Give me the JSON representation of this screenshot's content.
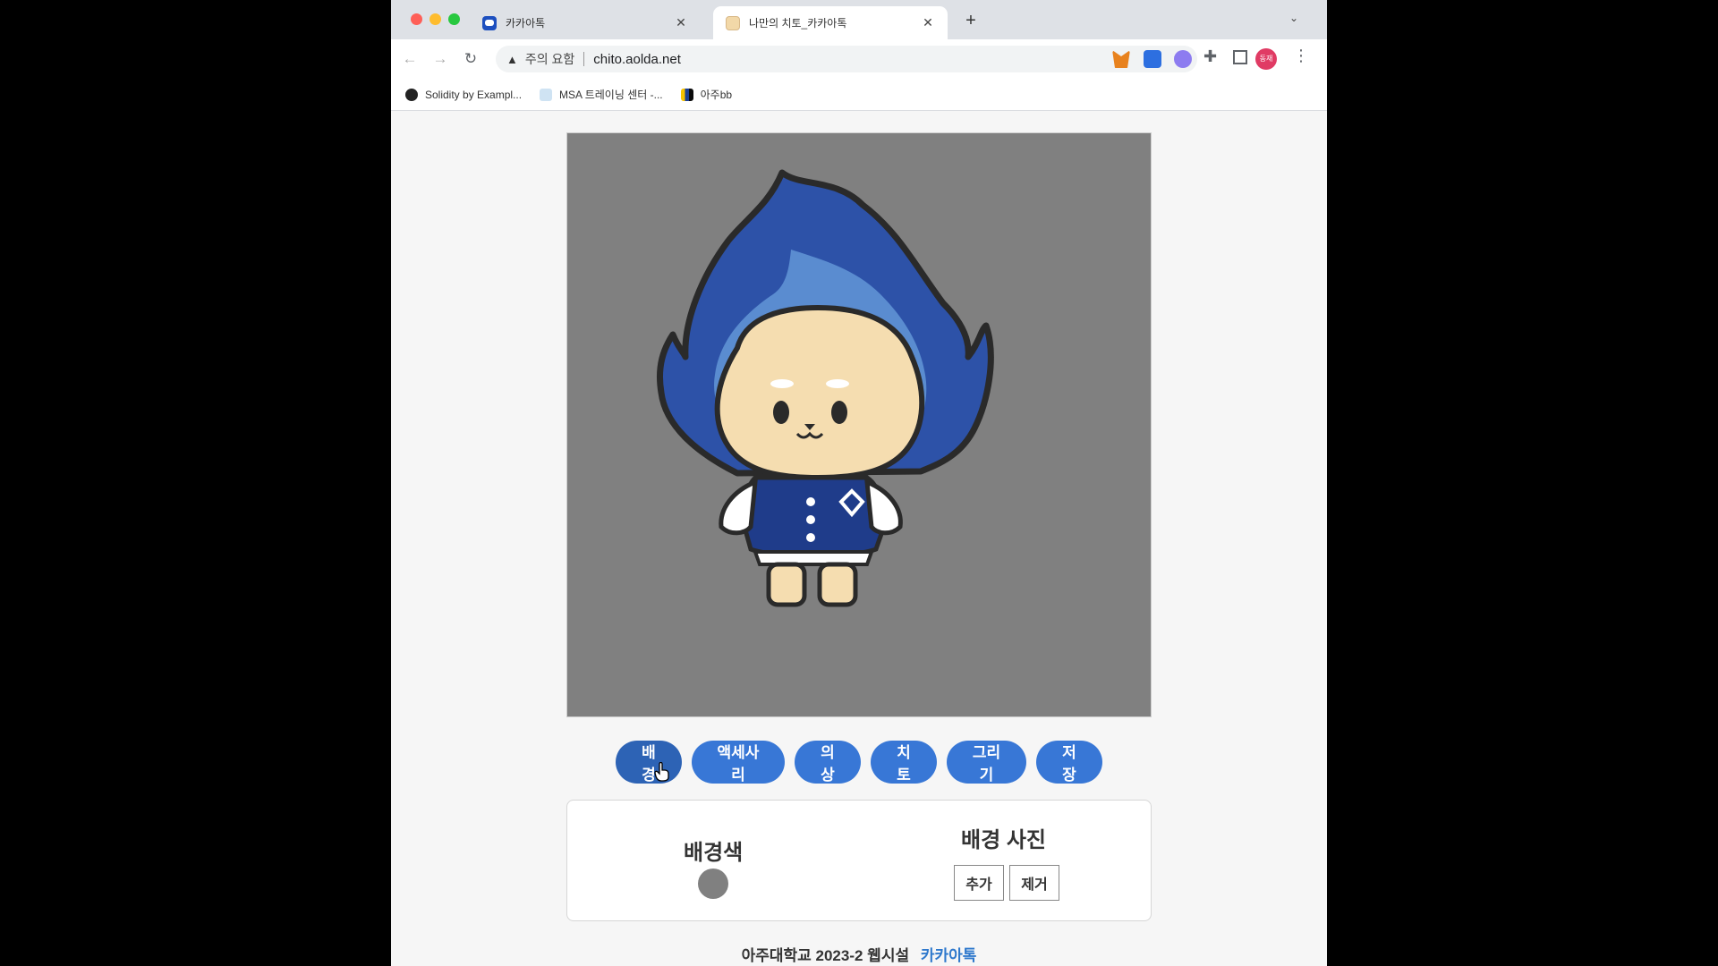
{
  "browser": {
    "tabs": [
      {
        "title": "카카아톡"
      },
      {
        "title": "나만의 치토_카카아톡"
      }
    ],
    "omnibox": {
      "warning": "주의 요함",
      "url": "chito.aolda.net"
    },
    "profile_initials": "동재",
    "bookmarks": [
      {
        "label": "Solidity by Exampl..."
      },
      {
        "label": "MSA 트레이닝 센터 -..."
      },
      {
        "label": "아주bb"
      }
    ]
  },
  "canvas": {
    "background_color": "#808080"
  },
  "toolbar": {
    "buttons": [
      {
        "label": "배경"
      },
      {
        "label": "액세사리"
      },
      {
        "label": "의상"
      },
      {
        "label": "치토"
      },
      {
        "label": "그리기"
      },
      {
        "label": "저장"
      }
    ],
    "active": "배경"
  },
  "panel": {
    "bg_color_title": "배경색",
    "bg_photo_title": "배경 사진",
    "add_label": "추가",
    "remove_label": "제거"
  },
  "footer": {
    "text": "아주대학교 2023-2 웹시설",
    "link": "카카아톡"
  }
}
